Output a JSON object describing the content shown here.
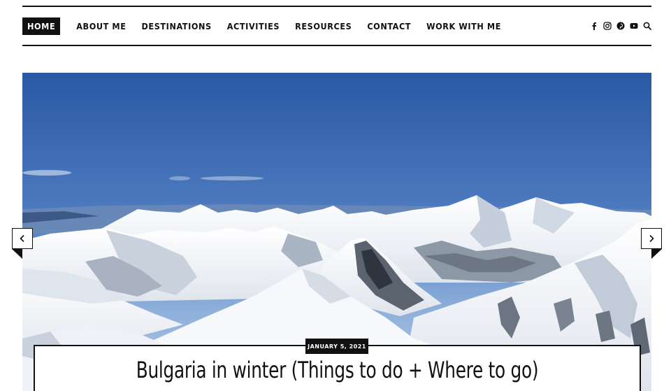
{
  "nav": {
    "items": [
      {
        "label": "HOME",
        "active": true
      },
      {
        "label": "ABOUT ME",
        "active": false
      },
      {
        "label": "DESTINATIONS",
        "active": false
      },
      {
        "label": "ACTIVITIES",
        "active": false
      },
      {
        "label": "RESOURCES",
        "active": false
      },
      {
        "label": "CONTACT",
        "active": false
      },
      {
        "label": "WORK WITH ME",
        "active": false
      }
    ],
    "icons": [
      "facebook-icon",
      "instagram-icon",
      "pinterest-icon",
      "youtube-icon",
      "search-icon"
    ]
  },
  "slider": {
    "image": "snowy-mountain-range",
    "prev_icon": "chevron-left-icon",
    "next_icon": "chevron-right-icon"
  },
  "post": {
    "date": "JANUARY 5, 2021",
    "title": "Bulgaria in winter (Things to do + Where to go)"
  },
  "colors": {
    "ink": "#111111",
    "sky_top": "#2c5aa4",
    "sky_bottom": "#8aaed8",
    "snow": "#f4f6f9"
  }
}
